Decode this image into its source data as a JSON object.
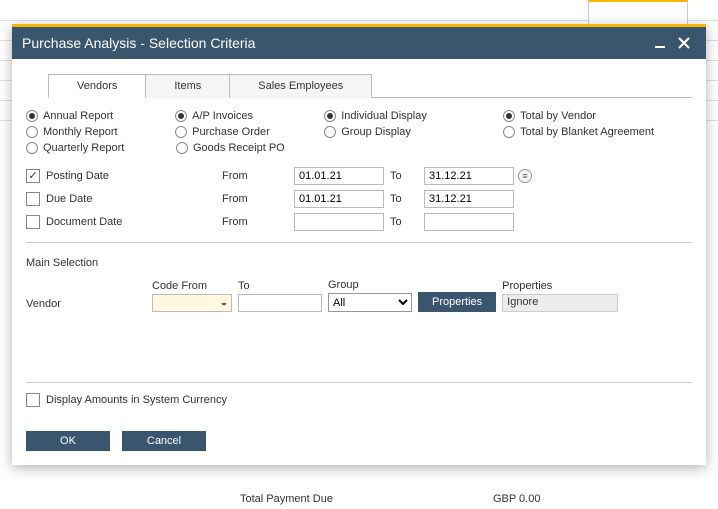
{
  "window": {
    "title": "Purchase Analysis - Selection Criteria"
  },
  "tabs": {
    "vendors": "Vendors",
    "items": "Items",
    "sales_employees": "Sales Employees",
    "active": "vendors"
  },
  "radios": {
    "period": {
      "annual": "Annual Report",
      "monthly": "Monthly Report",
      "quarterly": "Quarterly Report",
      "selected": "annual"
    },
    "doc": {
      "ap": "A/P Invoices",
      "po": "Purchase Order",
      "grpo": "Goods Receipt PO",
      "selected": "ap"
    },
    "display": {
      "individual": "Individual Display",
      "group": "Group Display",
      "selected": "individual"
    },
    "total": {
      "vendor": "Total by Vendor",
      "blanket": "Total by Blanket Agreement",
      "selected": "vendor"
    }
  },
  "dates": {
    "posting": {
      "label": "Posting Date",
      "checked": true,
      "from_lbl": "From",
      "to_lbl": "To",
      "from": "01.01.21",
      "to": "31.12.21"
    },
    "due": {
      "label": "Due Date",
      "checked": false,
      "from_lbl": "From",
      "to_lbl": "To",
      "from": "01.01.21",
      "to": "31.12.21"
    },
    "document": {
      "label": "Document Date",
      "checked": false,
      "from_lbl": "From",
      "to_lbl": "To",
      "from": "",
      "to": ""
    }
  },
  "main_selection": {
    "title": "Main Selection",
    "vendor_label": "Vendor",
    "code_from_label": "Code From",
    "code_from": "",
    "to_label": "To",
    "to": "",
    "group_label": "Group",
    "group": "All",
    "properties_btn": "Properties",
    "properties_label": "Properties",
    "properties_value": "Ignore"
  },
  "display_amounts": {
    "label": "Display Amounts in System Currency",
    "checked": false
  },
  "buttons": {
    "ok": "OK",
    "cancel": "Cancel"
  },
  "background_status": {
    "label": "Total Payment Due",
    "value": "GBP 0.00"
  }
}
